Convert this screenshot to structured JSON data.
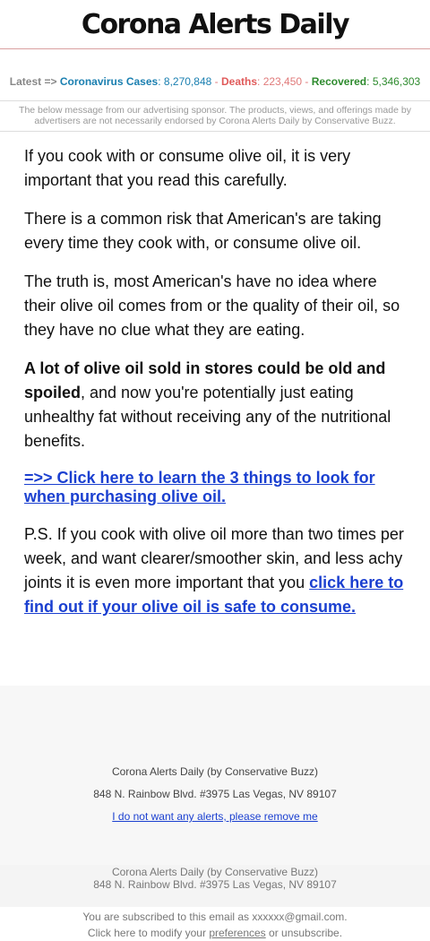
{
  "header": {
    "logo_text": "Corona Alerts Daily"
  },
  "ticker": {
    "latest_label": "Latest =>",
    "cases_label": "Coronavirus Cases",
    "cases_value": "8,270,848",
    "deaths_label": "Deaths",
    "deaths_value": "223,450",
    "recovered_label": "Recovered",
    "recovered_value": "5,346,303",
    "separator": "-",
    "colon": ":"
  },
  "disclaimer": "The below message from our advertising sponsor. The products, views, and offerings made by advertisers are not necessarily endorsed by Corona Alerts Daily by Conservative Buzz.",
  "content": {
    "p1": "If you cook with or consume olive oil, it is very important that you read this carefully.",
    "p2": "There is a common risk that American's are taking every time they cook with, or consume olive oil.",
    "p3": "The truth is, most American's have no idea where their olive oil comes from or the quality of their oil, so they have no clue what they are eating.",
    "p4_bold": "A lot of olive oil sold in stores could be old and spoiled",
    "p4_rest": ", and now you're potentially just eating unhealthy fat without receiving any of the nutritional benefits.",
    "cta_link": "=>> Click here to learn the 3 things to look for when purchasing olive oil.",
    "ps_text": "P.S. If you cook with olive oil more than two times per week, and want clearer/smoother skin, and less achy joints it is even more important that you ",
    "ps_link": "click here to find out if your olive oil is safe to consume."
  },
  "footer": {
    "company": "Corona Alerts Daily (by Conservative Buzz)",
    "address": "848 N. Rainbow Blvd. #3975 Las Vegas, NV 89107",
    "unsubscribe_link": "I do not want any alerts, please remove me"
  },
  "footer2": {
    "company": "Corona Alerts Daily (by Conservative Buzz)",
    "address": "848 N. Rainbow Blvd. #3975 Las Vegas, NV 89107"
  },
  "subscribe": {
    "line1": "You are subscribed to this email as xxxxxx@gmail.com.",
    "line2_prefix": "Click here to modify your ",
    "preferences_link": "preferences",
    "line2_suffix": " or unsubscribe."
  }
}
